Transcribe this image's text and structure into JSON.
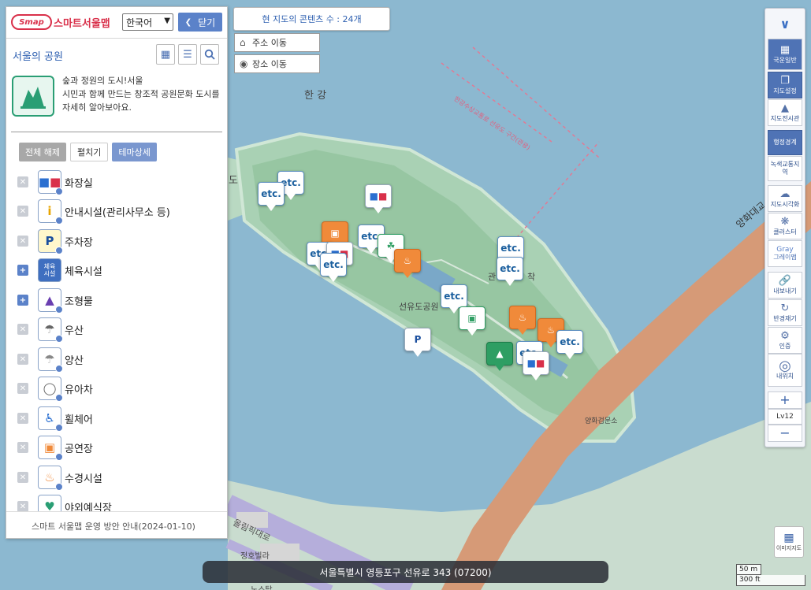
{
  "map": {
    "labels": {
      "river": "한 강",
      "park": "선유도공원",
      "bridge_right": "양화대교",
      "gate": "양화검문소",
      "road_bottom": "올림픽대로",
      "village": "정호빌라",
      "partial_bottom": "노스탑",
      "partial_left": "도",
      "partial_center": "관",
      "partial_center2": "착",
      "route": "한강수상교통로 선유도 구간(관광)"
    },
    "colors": {
      "water": "#8cb8d0",
      "land": "#b9d9c2",
      "park_land": "#9fcaa9",
      "bridge": "#d59b78",
      "road": "#c7bee0"
    }
  },
  "panel": {
    "logo_badge": "Smap",
    "logo_text": "스마트서울맵",
    "language": "한국어",
    "close_label": "닫기",
    "theme_title": "서울의 공원",
    "intro_line1": "숲과 정원의 도시!서울",
    "intro_line2": "시민과 함께 만드는 창조적 공원문화 도시를 자세히 알아보아요.",
    "buttons": {
      "disable_all": "전체 해제",
      "expand": "펼치기",
      "theme_detail": "테마상세"
    },
    "categories": [
      {
        "label": "화장실",
        "icon": "toilet-icon",
        "toggle": "x"
      },
      {
        "label": "안내시설(관리사무소 등)",
        "icon": "info-icon",
        "toggle": "x"
      },
      {
        "label": "주차장",
        "icon": "parking-icon",
        "toggle": "x"
      },
      {
        "label": "체육시설",
        "icon": "sports-icon",
        "toggle": "+"
      },
      {
        "label": "조형물",
        "icon": "sculpture-icon",
        "toggle": "+"
      },
      {
        "label": "우산",
        "icon": "umbrella-icon",
        "toggle": "x"
      },
      {
        "label": "양산",
        "icon": "parasol-icon",
        "toggle": "x"
      },
      {
        "label": "유아차",
        "icon": "stroller-icon",
        "toggle": "x"
      },
      {
        "label": "휠체어",
        "icon": "wheelchair-icon",
        "toggle": "x"
      },
      {
        "label": "공연장",
        "icon": "stage-icon",
        "toggle": "x"
      },
      {
        "label": "수경시설",
        "icon": "fountain-icon",
        "toggle": "x"
      },
      {
        "label": "야외예식장",
        "icon": "wedding-icon",
        "toggle": "x"
      }
    ],
    "sports_icon_text": "체육\n시설",
    "footer": "스마트 서울맵 운영 방안 안내(2024-01-10)"
  },
  "top": {
    "content_count": "현 지도의 콘텐츠 수 : 24개",
    "address_move": "주소 이동",
    "place_move": "장소 이동"
  },
  "toolbar": {
    "basemap": "국운일반",
    "map_settings": "지도설정",
    "map_exhibit": "지도전시관",
    "admin_boundary": "행정경계",
    "green_transport": "녹색교통지역",
    "map_visual": "지도시각화",
    "cluster": "클러스터",
    "gray": "Gray",
    "gray_map": "그레이맵",
    "export": "내보내기",
    "reset": "반경재기",
    "auth": "인증",
    "my_location": "내위치",
    "zoom_level": "Lv12",
    "zoom_in": "+",
    "zoom_out": "−"
  },
  "image_map": "이미지지도",
  "address": "서울특별시 영등포구 선유로 343 (07200)",
  "scale": {
    "metric": "50 m",
    "imperial": "300 ft"
  },
  "markers": {
    "etc": "etc."
  }
}
